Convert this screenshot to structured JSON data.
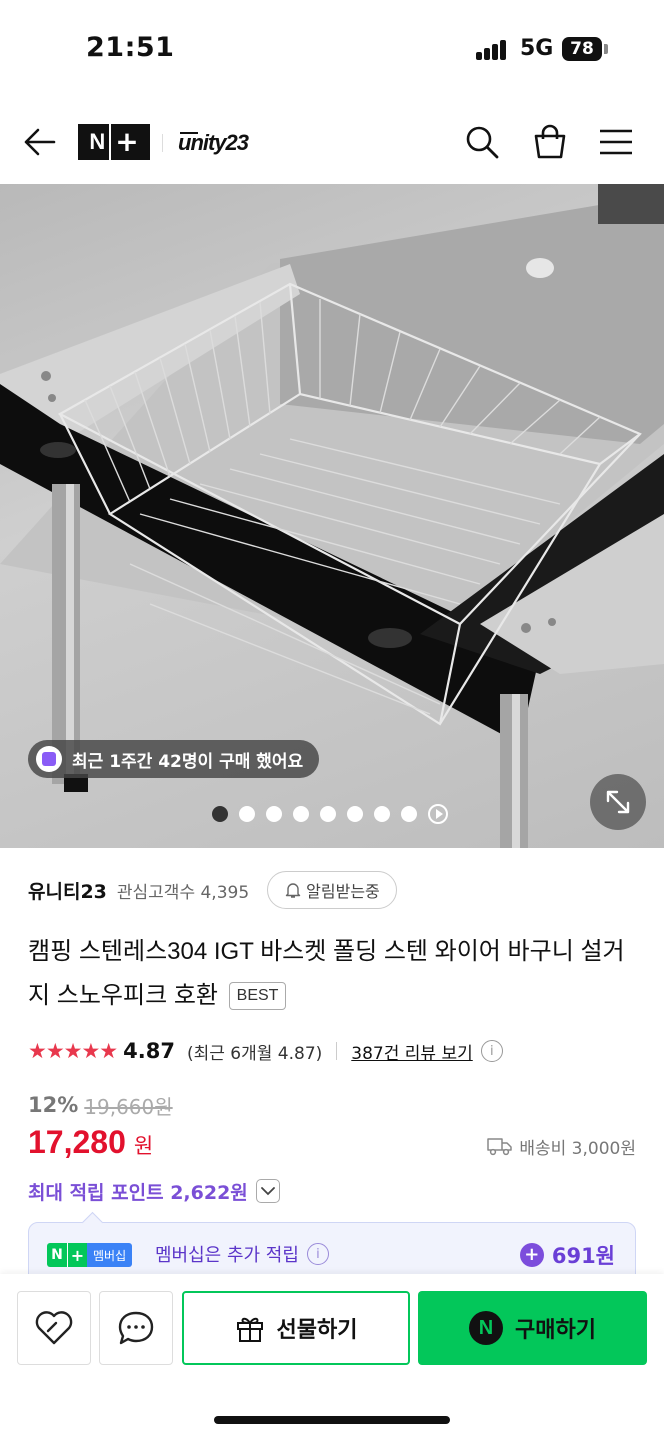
{
  "status_bar": {
    "time": "21:51",
    "network": "5G",
    "battery": "78"
  },
  "header": {
    "brand_badge_n": "N",
    "brand_badge_plus": "+",
    "store_logo_text": "unity23"
  },
  "hero": {
    "recent_purchase_text": "최근 1주간 42명이 구매 했어요",
    "dot_count": 8,
    "active_dot": 0
  },
  "seller": {
    "name": "유니티23",
    "fans": "관심고객수 4,395",
    "notify_label": "알림받는중"
  },
  "product": {
    "title": "캠핑 스텐레스304 IGT 바스켓 폴딩 스텐 와이어 바구니 설거지 스노우피크 호환",
    "badge": "BEST"
  },
  "rating": {
    "stars": "★★★★★",
    "score": "4.87",
    "recent": "(최근 6개월 4.87)",
    "review_link": "387건 리뷰 보기",
    "info": "i"
  },
  "price": {
    "discount_rate": "12%",
    "original": "19,660원",
    "sale": "17,280",
    "unit": "원",
    "shipping": "배송비 3,000원"
  },
  "points": {
    "label": "최대 적립 포인트 2,622원"
  },
  "membership": {
    "badge_n": "N",
    "badge_plus": "+",
    "badge_label": "멤버십",
    "text": "멤버십은 추가 적립",
    "info": "i",
    "plus": "+",
    "points": "691원"
  },
  "bottom_bar": {
    "gift_label": "선물하기",
    "buy_label": "구매하기",
    "buy_icon": "N"
  },
  "colors": {
    "accent_green": "#03c75a",
    "price_red": "#e2112d",
    "points_purple": "#7a4fd6",
    "star_red": "#e8384d"
  },
  "icons": [
    "back-arrow-icon",
    "search-icon",
    "shopping-bag-icon",
    "hamburger-menu-icon",
    "expand-icon",
    "bell-icon",
    "info-icon",
    "truck-icon",
    "chevron-down-icon",
    "heart-icon",
    "chat-icon",
    "gift-icon"
  ]
}
